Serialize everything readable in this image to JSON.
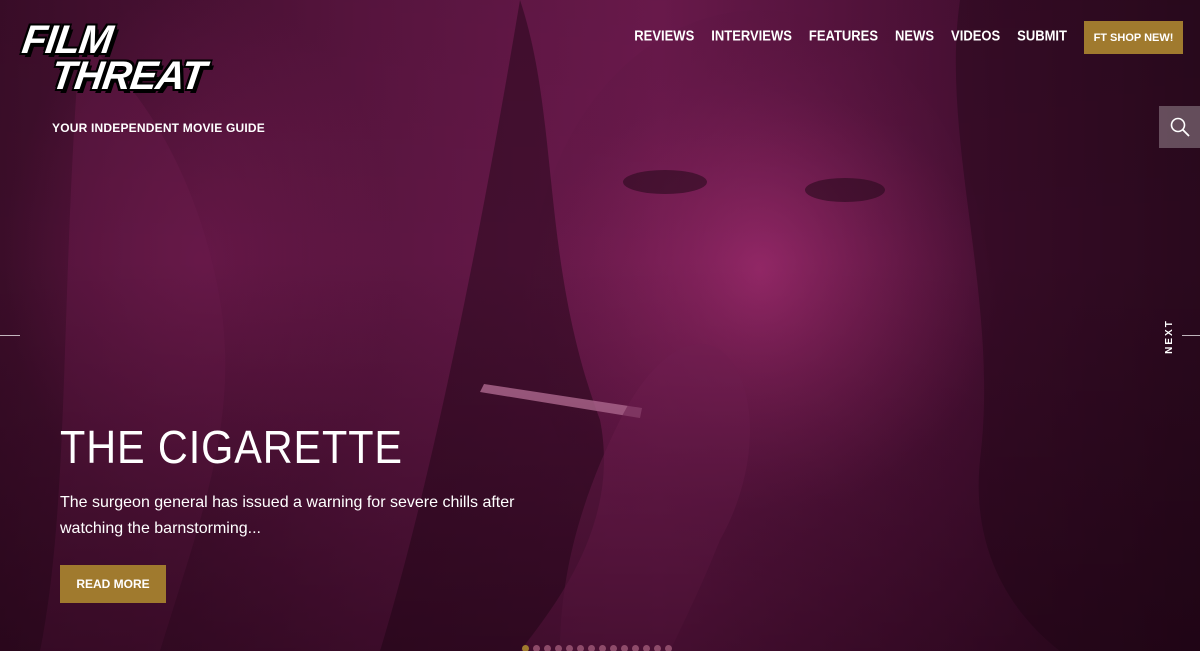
{
  "brand": {
    "logo_line1": "FILM",
    "logo_line2": "THREAT",
    "tagline": "YOUR INDEPENDENT MOVIE GUIDE"
  },
  "nav": {
    "items": [
      "REVIEWS",
      "INTERVIEWS",
      "FEATURES",
      "NEWS",
      "VIDEOS",
      "SUBMIT"
    ],
    "shop_label": "FT SHOP NEW!"
  },
  "slider": {
    "next_label": "NEXT",
    "title": "THE CIGARETTE",
    "excerpt": "The surgeon general has issued a warning for severe chills after watching the barnstorming...",
    "read_more_label": "READ MORE",
    "active_slide_index": 0
  },
  "icons": {
    "search": "search-icon",
    "prev": "prev-line-icon",
    "next": "next-line-icon"
  },
  "colors": {
    "accent": "#a07a2e",
    "overlay": "#6d1a4e"
  }
}
